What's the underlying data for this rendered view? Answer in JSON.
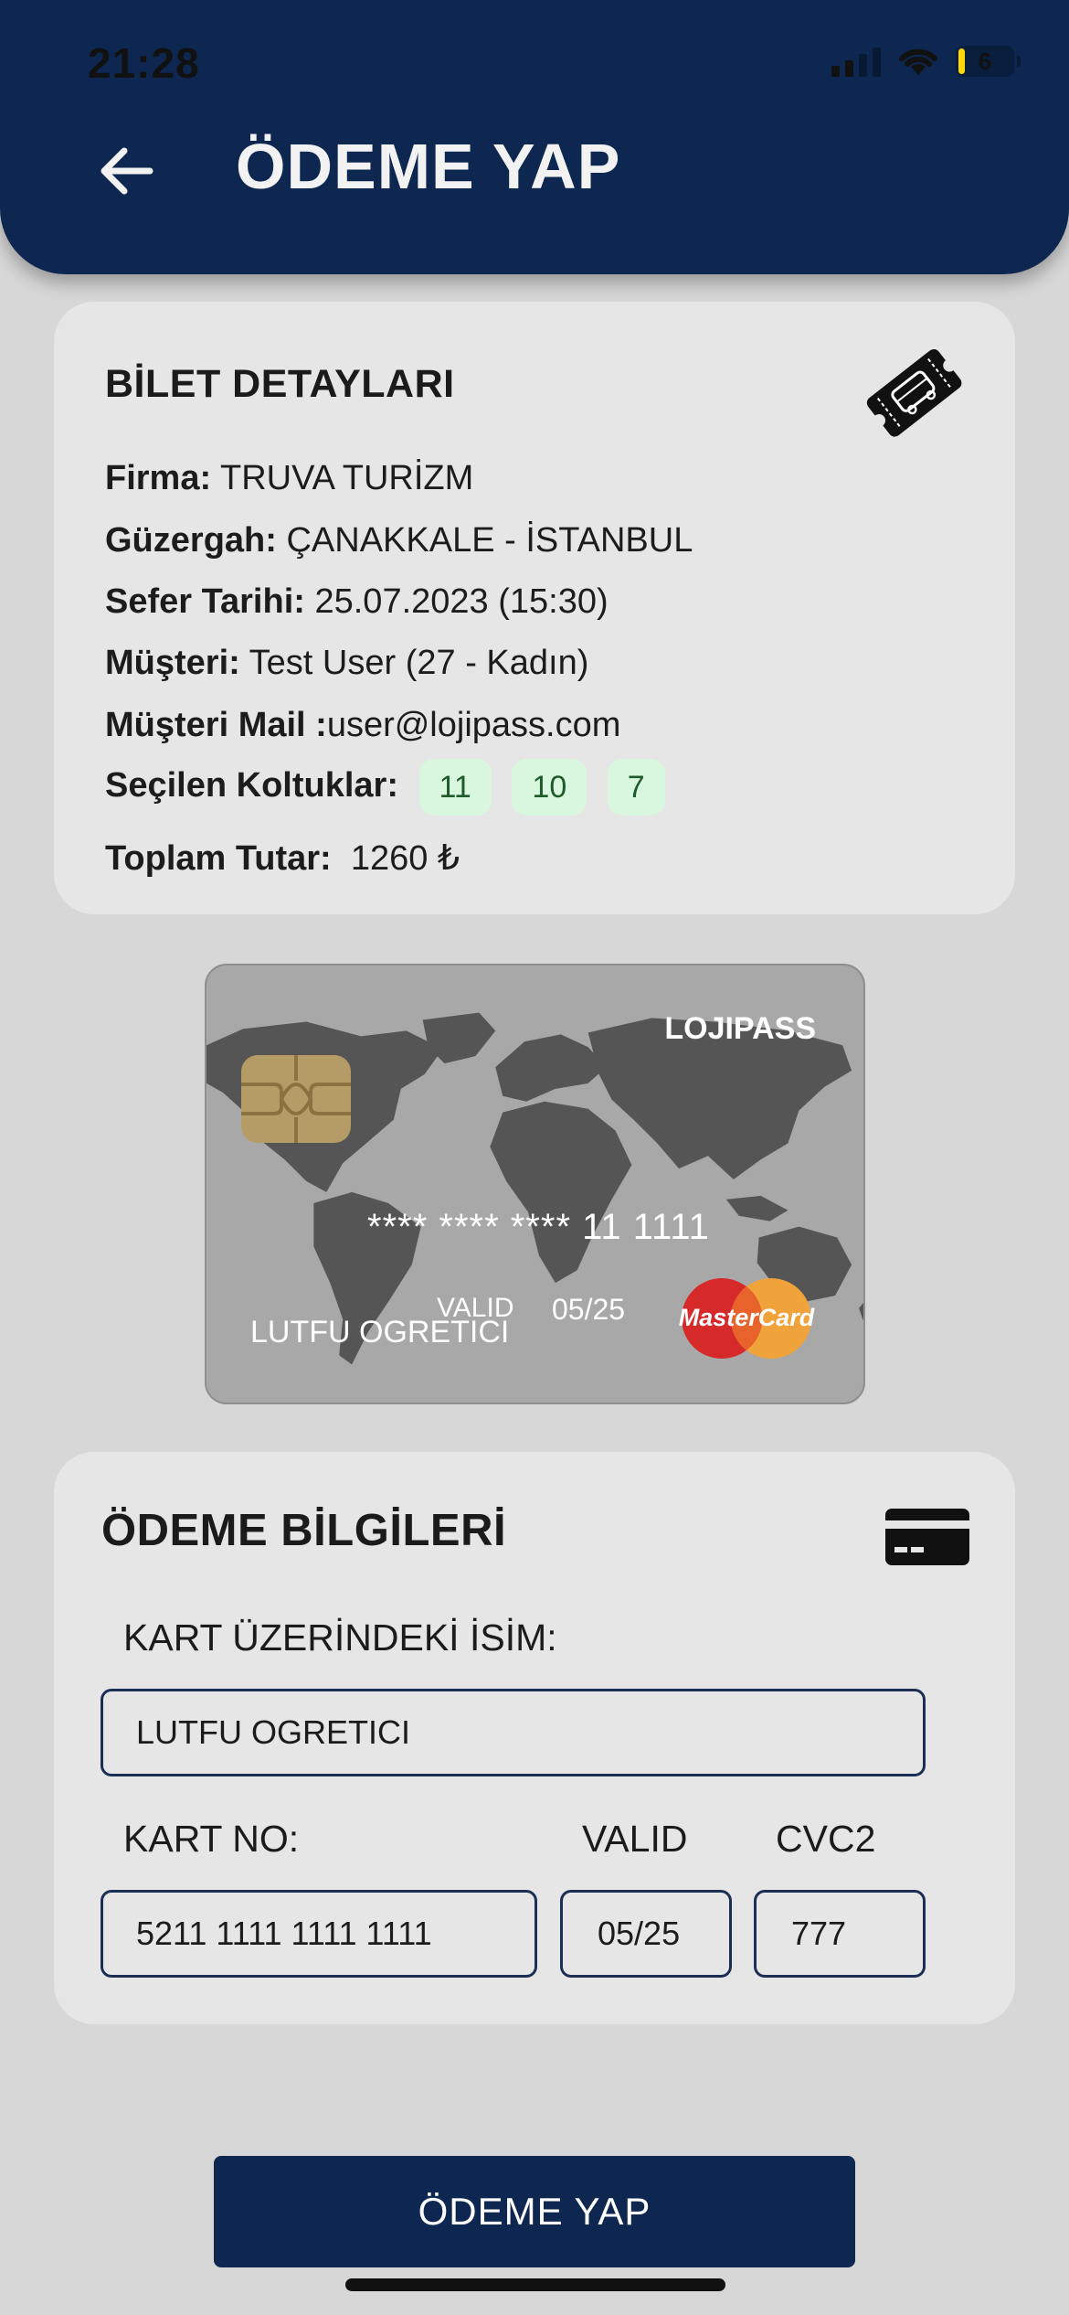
{
  "status_bar": {
    "time": "21:28",
    "battery": "6"
  },
  "header": {
    "title": "ÖDEME YAP"
  },
  "ticket_details": {
    "title": "BİLET DETAYLARI",
    "firma_label": "Firma:",
    "firma_value": "TRUVA TURİZM",
    "guzergah_label": "Güzergah:",
    "guzergah_value": "ÇANAKKALE - İSTANBUL",
    "sefer_label": "Sefer Tarihi:",
    "sefer_value": "25.07.2023 (15:30)",
    "musteri_label": "Müşteri:",
    "musteri_value": "Test User (27 - Kadın)",
    "mail_label": "Müşteri Mail :",
    "mail_value": "user@lojipass.com",
    "seats_label": "Seçilen Koltuklar:",
    "seats": [
      "11",
      "10",
      "7"
    ],
    "total_label": "Toplam Tutar:",
    "total_value": "1260 ₺"
  },
  "card_preview": {
    "brand": "LOJIPASS",
    "number": "**** **** **** 11 1111",
    "valid_label": "VALID",
    "valid_value": "05/25",
    "holder": "LUTFU OGRETICI",
    "network": "MasterCard"
  },
  "payment_info": {
    "title": "ÖDEME BİLGİLERİ",
    "name_label": "KART ÜZERİNDEKİ İSİM:",
    "name_value": "LUTFU OGRETICI",
    "card_no_label": "KART NO:",
    "card_no_value": "5211 1111 1111 1111",
    "valid_label": "VALID",
    "valid_value": "05/25",
    "cvc_label": "CVC2",
    "cvc_value": "777"
  },
  "actions": {
    "pay_label": "ÖDEME YAP"
  },
  "colors": {
    "primary": "#0d2750",
    "seat_chip": "#d9f7de",
    "background": "#d7d7d7"
  }
}
